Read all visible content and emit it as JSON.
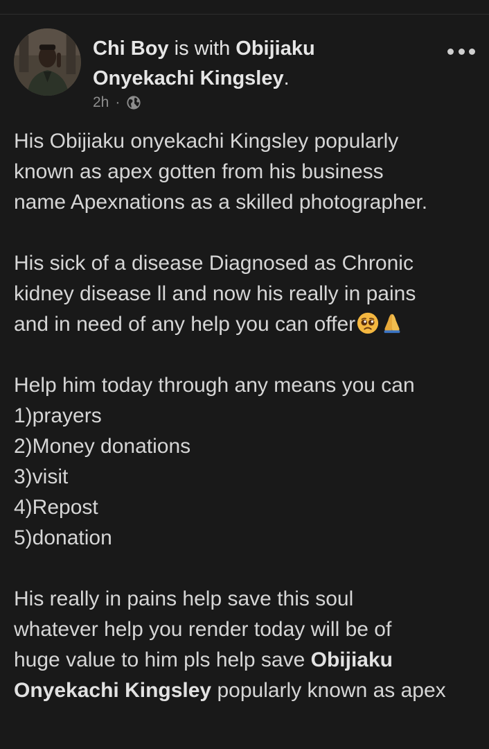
{
  "post": {
    "author": "Chi Boy",
    "with_text": "is with",
    "tagged_person_line1": "Obijiaku",
    "tagged_person_line2": "Onyekachi Kingsley",
    "tagged_period": ".",
    "time": "2h",
    "separator": "·",
    "audience_icon": "globe-icon",
    "more_icon": "more-options-icon",
    "paragraphs": {
      "p1": [
        "His Obijiaku onyekachi Kingsley popularly",
        "known as apex gotten from his business",
        "name Apexnations as a skilled photographer."
      ],
      "p2": [
        "His sick of a disease Diagnosed as Chronic",
        "kidney disease ll and now his really in pains",
        "and in need of any help you can offer"
      ],
      "p2_emojis": [
        "pleading-face-emoji",
        "folded-hands-emoji"
      ],
      "p3_intro": "Help him today through any means you can",
      "help_list": [
        "1)prayers",
        "2)Money donations",
        "3)visit",
        "4)Repost",
        "5)donation"
      ],
      "p4": [
        "His really in pains help save this soul",
        "whatever help you render today will be of"
      ],
      "p4_line3_prefix": "huge value to him pls help save ",
      "p4_bold_first": "Obijiaku",
      "p4_bold_second": "Onyekachi Kingsley",
      "p4_suffix": " popularly known as apex"
    }
  },
  "colors": {
    "background": "#191919",
    "text": "#d6d6d6",
    "meta": "#8d8d8d"
  }
}
